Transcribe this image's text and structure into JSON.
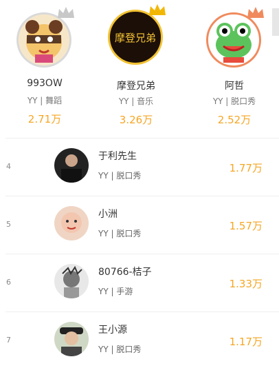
{
  "top3": [
    {
      "name": "993OW",
      "category": "YY | 舞蹈",
      "score": "2.71万"
    },
    {
      "name": "摩登兄弟",
      "category": "YY | 音乐",
      "score": "3.26万",
      "avatar_text": "摩登兄弟"
    },
    {
      "name": "阿哲",
      "category": "YY | 脱口秀",
      "score": "2.52万"
    }
  ],
  "list": [
    {
      "rank": "4",
      "name": "于利先生",
      "category": "YY | 脱口秀",
      "score": "1.77万"
    },
    {
      "rank": "5",
      "name": "小洲",
      "category": "YY | 脱口秀",
      "score": "1.57万"
    },
    {
      "rank": "6",
      "name": "80766-桔子",
      "category": "YY | 手游",
      "score": "1.33万"
    },
    {
      "rank": "7",
      "name": "王小源",
      "category": "YY | 脱口秀",
      "score": "1.17万"
    }
  ],
  "colors": {
    "accent": "#f5a623",
    "gold_crown": "#f2b705",
    "silver_crown": "#c8c8c8",
    "bronze_crown": "#f08a5d"
  }
}
